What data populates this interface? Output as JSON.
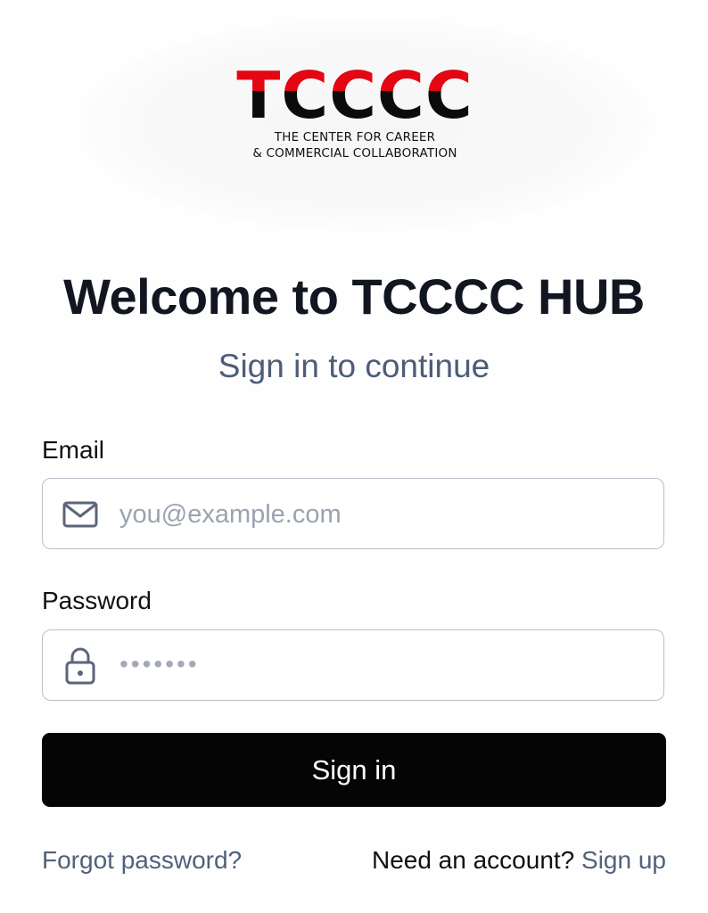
{
  "logo": {
    "letters": "TCCCC",
    "tagline_line1": "THE CENTER FOR CAREER",
    "tagline_line2": "& COMMERCIAL COLLABORATION",
    "top_color": "#e30613",
    "bottom_color": "#0b0b0b"
  },
  "header": {
    "title": "Welcome to TCCCC HUB",
    "subtitle": "Sign in to continue"
  },
  "form": {
    "email": {
      "label": "Email",
      "placeholder": "you@example.com",
      "icon": "mail-icon"
    },
    "password": {
      "label": "Password",
      "placeholder": "•••••••",
      "icon": "lock-icon"
    },
    "submit_label": "Sign in"
  },
  "footer": {
    "forgot_label": "Forgot password?",
    "need_account_text": "Need an account?",
    "signup_label": "Sign up"
  },
  "colors": {
    "link": "#51617c",
    "button_bg": "#050505",
    "title": "#121620",
    "subtitle": "#4d5d78"
  }
}
